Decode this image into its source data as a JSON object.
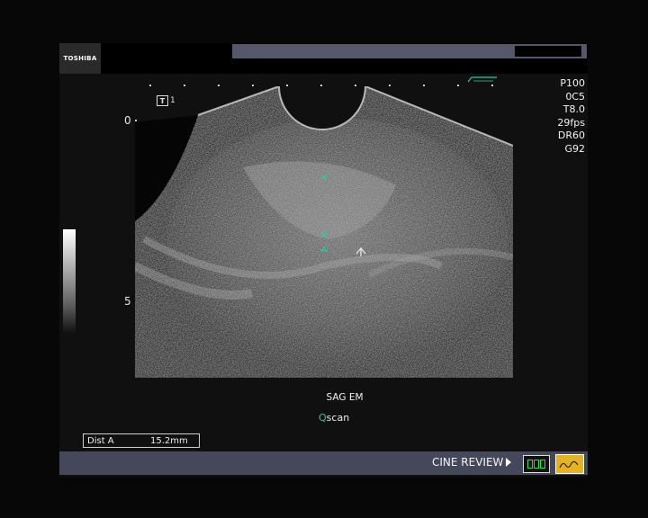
{
  "header": {
    "brand": "TOSHIBA"
  },
  "params": [
    "P100",
    "0C5",
    "T8.0",
    "29fps",
    "DR60",
    "G92"
  ],
  "overlay": {
    "t_marker": "1",
    "depth_top": "0",
    "depth_mid": "5"
  },
  "labels": {
    "view": "SAG EM",
    "mode_q": "Q",
    "mode_rest": "scan"
  },
  "measurement": {
    "label": "Dist A",
    "value": "15.2mm"
  },
  "footer": {
    "cine_label": "CINE REVIEW"
  },
  "colors": {
    "caliper": "#2ec7a8",
    "footer_bar": "#45475a",
    "header_strip": "#55586a",
    "function_button": "#e3b227"
  }
}
